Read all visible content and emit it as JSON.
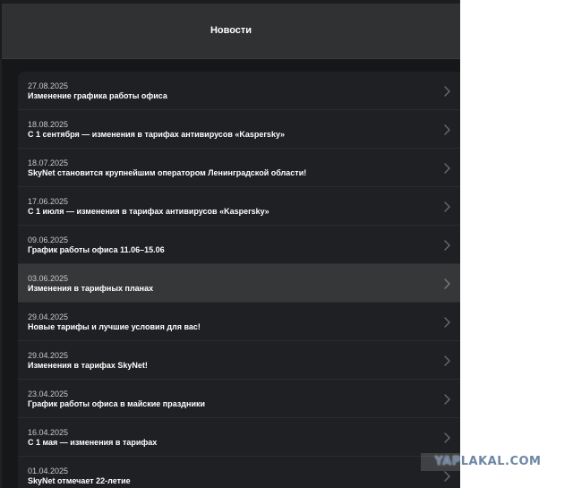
{
  "header": {
    "title": "Новости"
  },
  "news": [
    {
      "date": "27.08.2025",
      "title": "Изменение графика работы офиса"
    },
    {
      "date": "18.08.2025",
      "title": "С 1 сентября — изменения в тарифах антивирусов «Kaspersky»"
    },
    {
      "date": "18.07.2025",
      "title": "SkyNet становится крупнейшим оператором Ленинградской области!"
    },
    {
      "date": "17.06.2025",
      "title": "С 1 июля — изменения в тарифах антивирусов «Kaspersky»"
    },
    {
      "date": "09.06.2025",
      "title": "График работы офиса 11.06–15.06"
    },
    {
      "date": "03.06.2025",
      "title": "Изменения в тарифных планах"
    },
    {
      "date": "29.04.2025",
      "title": "Новые тарифы и лучшие условия для вас!"
    },
    {
      "date": "29.04.2025",
      "title": "Изменения в тарифах SkyNet!"
    },
    {
      "date": "23.04.2025",
      "title": "График работы офиса в майские праздники"
    },
    {
      "date": "16.04.2025",
      "title": "С 1 мая — изменения в тарифах"
    },
    {
      "date": "01.04.2025",
      "title": "SkyNet отмечает 22-летие"
    }
  ],
  "icons": {
    "item_arrow": "chevron-right-icon"
  },
  "colors": {
    "background": "#161719",
    "header": "#303133",
    "list": "#1f2023",
    "highlight": "#363739"
  },
  "watermark": {
    "text": "YAPLAKAL.COM"
  }
}
